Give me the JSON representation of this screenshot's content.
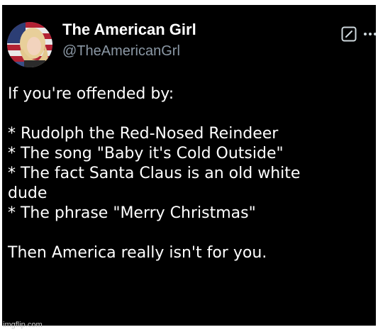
{
  "post": {
    "display_name": "The American Girl",
    "handle": "@TheAmericanGrl",
    "avatar_icon": "profile-photo",
    "edit_icon": "edit-icon",
    "more_icon": "more-options-icon",
    "body_lines": [
      "If you're offended by:",
      "",
      "* Rudolph the Red-Nosed Reindeer",
      "* The song \"Baby it's Cold Outside\"",
      "* The fact Santa Claus is an old white",
      "dude",
      "* The phrase \"Merry Christmas\"",
      "",
      "Then America really isn't for you."
    ]
  },
  "watermark": "imgflip.com",
  "colors": {
    "background": "#000000",
    "text": "#ffffff",
    "handle": "#8b98a5"
  }
}
